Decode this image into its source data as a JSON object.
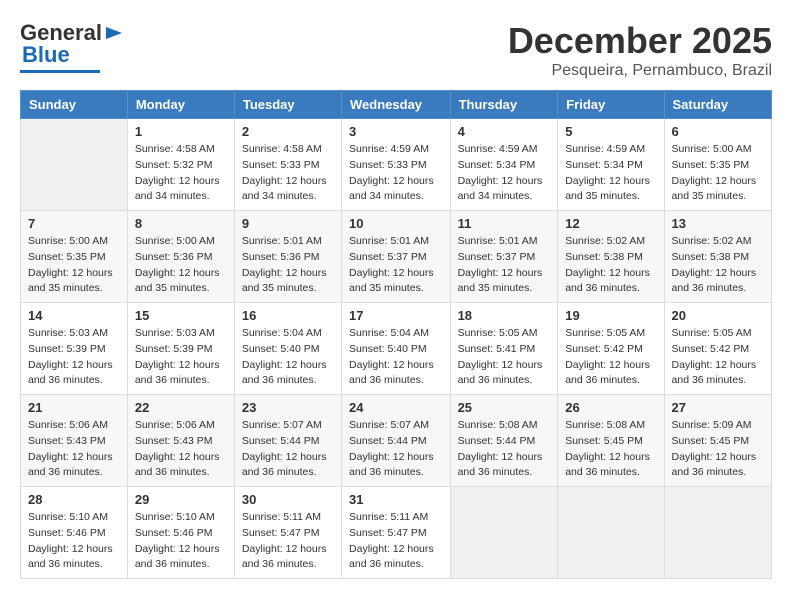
{
  "header": {
    "logo_general": "General",
    "logo_blue": "Blue",
    "month": "December 2025",
    "location": "Pesqueira, Pernambuco, Brazil"
  },
  "weekdays": [
    "Sunday",
    "Monday",
    "Tuesday",
    "Wednesday",
    "Thursday",
    "Friday",
    "Saturday"
  ],
  "weeks": [
    [
      {
        "day": "",
        "sunrise": "",
        "sunset": "",
        "daylight": ""
      },
      {
        "day": "1",
        "sunrise": "Sunrise: 4:58 AM",
        "sunset": "Sunset: 5:32 PM",
        "daylight": "Daylight: 12 hours and 34 minutes."
      },
      {
        "day": "2",
        "sunrise": "Sunrise: 4:58 AM",
        "sunset": "Sunset: 5:33 PM",
        "daylight": "Daylight: 12 hours and 34 minutes."
      },
      {
        "day": "3",
        "sunrise": "Sunrise: 4:59 AM",
        "sunset": "Sunset: 5:33 PM",
        "daylight": "Daylight: 12 hours and 34 minutes."
      },
      {
        "day": "4",
        "sunrise": "Sunrise: 4:59 AM",
        "sunset": "Sunset: 5:34 PM",
        "daylight": "Daylight: 12 hours and 34 minutes."
      },
      {
        "day": "5",
        "sunrise": "Sunrise: 4:59 AM",
        "sunset": "Sunset: 5:34 PM",
        "daylight": "Daylight: 12 hours and 35 minutes."
      },
      {
        "day": "6",
        "sunrise": "Sunrise: 5:00 AM",
        "sunset": "Sunset: 5:35 PM",
        "daylight": "Daylight: 12 hours and 35 minutes."
      }
    ],
    [
      {
        "day": "7",
        "sunrise": "Sunrise: 5:00 AM",
        "sunset": "Sunset: 5:35 PM",
        "daylight": "Daylight: 12 hours and 35 minutes."
      },
      {
        "day": "8",
        "sunrise": "Sunrise: 5:00 AM",
        "sunset": "Sunset: 5:36 PM",
        "daylight": "Daylight: 12 hours and 35 minutes."
      },
      {
        "day": "9",
        "sunrise": "Sunrise: 5:01 AM",
        "sunset": "Sunset: 5:36 PM",
        "daylight": "Daylight: 12 hours and 35 minutes."
      },
      {
        "day": "10",
        "sunrise": "Sunrise: 5:01 AM",
        "sunset": "Sunset: 5:37 PM",
        "daylight": "Daylight: 12 hours and 35 minutes."
      },
      {
        "day": "11",
        "sunrise": "Sunrise: 5:01 AM",
        "sunset": "Sunset: 5:37 PM",
        "daylight": "Daylight: 12 hours and 35 minutes."
      },
      {
        "day": "12",
        "sunrise": "Sunrise: 5:02 AM",
        "sunset": "Sunset: 5:38 PM",
        "daylight": "Daylight: 12 hours and 36 minutes."
      },
      {
        "day": "13",
        "sunrise": "Sunrise: 5:02 AM",
        "sunset": "Sunset: 5:38 PM",
        "daylight": "Daylight: 12 hours and 36 minutes."
      }
    ],
    [
      {
        "day": "14",
        "sunrise": "Sunrise: 5:03 AM",
        "sunset": "Sunset: 5:39 PM",
        "daylight": "Daylight: 12 hours and 36 minutes."
      },
      {
        "day": "15",
        "sunrise": "Sunrise: 5:03 AM",
        "sunset": "Sunset: 5:39 PM",
        "daylight": "Daylight: 12 hours and 36 minutes."
      },
      {
        "day": "16",
        "sunrise": "Sunrise: 5:04 AM",
        "sunset": "Sunset: 5:40 PM",
        "daylight": "Daylight: 12 hours and 36 minutes."
      },
      {
        "day": "17",
        "sunrise": "Sunrise: 5:04 AM",
        "sunset": "Sunset: 5:40 PM",
        "daylight": "Daylight: 12 hours and 36 minutes."
      },
      {
        "day": "18",
        "sunrise": "Sunrise: 5:05 AM",
        "sunset": "Sunset: 5:41 PM",
        "daylight": "Daylight: 12 hours and 36 minutes."
      },
      {
        "day": "19",
        "sunrise": "Sunrise: 5:05 AM",
        "sunset": "Sunset: 5:42 PM",
        "daylight": "Daylight: 12 hours and 36 minutes."
      },
      {
        "day": "20",
        "sunrise": "Sunrise: 5:05 AM",
        "sunset": "Sunset: 5:42 PM",
        "daylight": "Daylight: 12 hours and 36 minutes."
      }
    ],
    [
      {
        "day": "21",
        "sunrise": "Sunrise: 5:06 AM",
        "sunset": "Sunset: 5:43 PM",
        "daylight": "Daylight: 12 hours and 36 minutes."
      },
      {
        "day": "22",
        "sunrise": "Sunrise: 5:06 AM",
        "sunset": "Sunset: 5:43 PM",
        "daylight": "Daylight: 12 hours and 36 minutes."
      },
      {
        "day": "23",
        "sunrise": "Sunrise: 5:07 AM",
        "sunset": "Sunset: 5:44 PM",
        "daylight": "Daylight: 12 hours and 36 minutes."
      },
      {
        "day": "24",
        "sunrise": "Sunrise: 5:07 AM",
        "sunset": "Sunset: 5:44 PM",
        "daylight": "Daylight: 12 hours and 36 minutes."
      },
      {
        "day": "25",
        "sunrise": "Sunrise: 5:08 AM",
        "sunset": "Sunset: 5:44 PM",
        "daylight": "Daylight: 12 hours and 36 minutes."
      },
      {
        "day": "26",
        "sunrise": "Sunrise: 5:08 AM",
        "sunset": "Sunset: 5:45 PM",
        "daylight": "Daylight: 12 hours and 36 minutes."
      },
      {
        "day": "27",
        "sunrise": "Sunrise: 5:09 AM",
        "sunset": "Sunset: 5:45 PM",
        "daylight": "Daylight: 12 hours and 36 minutes."
      }
    ],
    [
      {
        "day": "28",
        "sunrise": "Sunrise: 5:10 AM",
        "sunset": "Sunset: 5:46 PM",
        "daylight": "Daylight: 12 hours and 36 minutes."
      },
      {
        "day": "29",
        "sunrise": "Sunrise: 5:10 AM",
        "sunset": "Sunset: 5:46 PM",
        "daylight": "Daylight: 12 hours and 36 minutes."
      },
      {
        "day": "30",
        "sunrise": "Sunrise: 5:11 AM",
        "sunset": "Sunset: 5:47 PM",
        "daylight": "Daylight: 12 hours and 36 minutes."
      },
      {
        "day": "31",
        "sunrise": "Sunrise: 5:11 AM",
        "sunset": "Sunset: 5:47 PM",
        "daylight": "Daylight: 12 hours and 36 minutes."
      },
      {
        "day": "",
        "sunrise": "",
        "sunset": "",
        "daylight": ""
      },
      {
        "day": "",
        "sunrise": "",
        "sunset": "",
        "daylight": ""
      },
      {
        "day": "",
        "sunrise": "",
        "sunset": "",
        "daylight": ""
      }
    ]
  ]
}
